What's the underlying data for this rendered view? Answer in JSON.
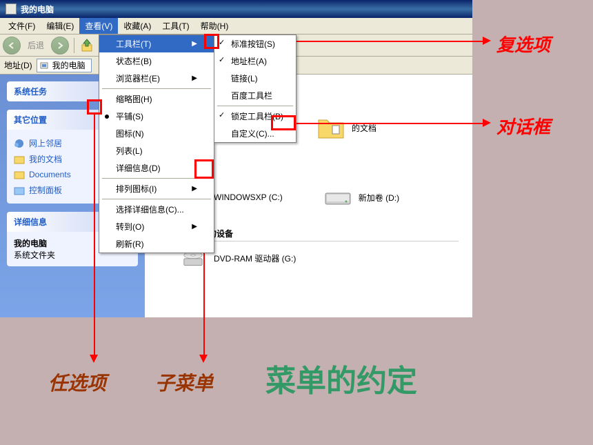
{
  "window": {
    "title": "我的电脑"
  },
  "menubar": {
    "file": "文件(F)",
    "edit": "编辑(E)",
    "view": "查看(V)",
    "favorites": "收藏(A)",
    "tools": "工具(T)",
    "help": "帮助(H)"
  },
  "toolbar": {
    "back": "后退"
  },
  "addressbar": {
    "label": "地址(D)",
    "value": "我的电脑"
  },
  "sidebar": {
    "tasks_header": "系统任务",
    "other_header": "其它位置",
    "details_header": "详细信息",
    "other_items": {
      "network": "网上邻居",
      "docs": "我的文档",
      "documents": "Documents",
      "control": "控制面板"
    },
    "details": {
      "name": "我的电脑",
      "type": "系统文件夹"
    }
  },
  "main": {
    "item_docs": "的文档",
    "item_windowsxp": "WINDOWSXP (C:)",
    "item_newvol": "新加卷 (D:)",
    "section_removable": "有可移动存储的设备",
    "item_dvd": "DVD-RAM 驱动器 (G:)"
  },
  "dropdown": {
    "toolbars": "工具栏(T)",
    "statusbar": "状态栏(B)",
    "explorer": "浏览器栏(E)",
    "thumbnails": "缩略图(H)",
    "tiles": "平铺(S)",
    "icons": "图标(N)",
    "list": "列表(L)",
    "details": "详细信息(D)",
    "arrange": "排列图标(I)",
    "choose": "选择详细信息(C)...",
    "goto": "转到(O)",
    "refresh": "刷新(R)"
  },
  "submenu": {
    "standard": "标准按钮(S)",
    "address": "地址栏(A)",
    "links": "链接(L)",
    "baidu": "百度工具栏",
    "lock": "锁定工具栏(B)",
    "customize": "自定义(C)..."
  },
  "annotations": {
    "checkbox": "复选项",
    "dialog": "对话框",
    "radio": "任选项",
    "submenu": "子菜单",
    "title": "菜单的约定"
  }
}
